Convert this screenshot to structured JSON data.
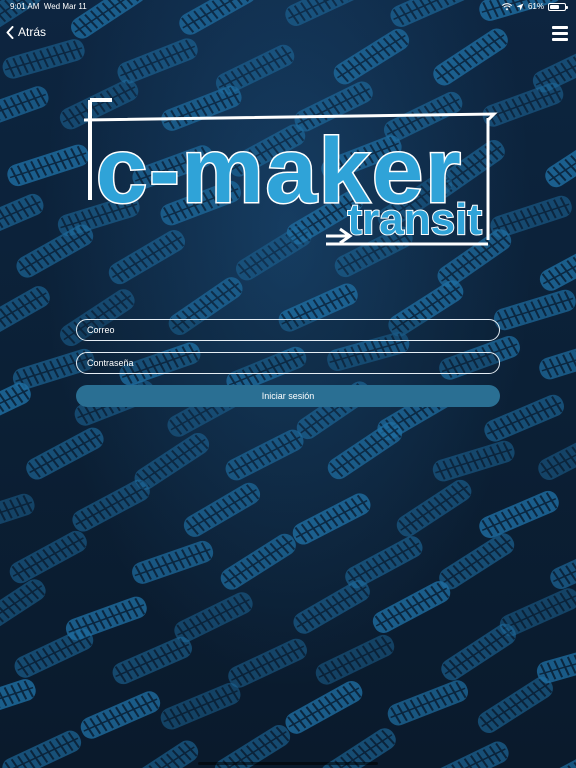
{
  "status_bar": {
    "time": "9:01 AM",
    "date": "Wed Mar 11",
    "battery_percent": "61%",
    "battery_level": 0.61,
    "icons": [
      "wifi-icon",
      "location-arrow-icon",
      "battery-icon"
    ]
  },
  "nav": {
    "back_label": "Atrás",
    "back_icon": "chevron-left-icon",
    "menu_icon": "hamburger-menu-icon"
  },
  "logo": {
    "line1": "c-maker",
    "line2": "transit"
  },
  "form": {
    "email_placeholder": "Correo",
    "password_placeholder": "Contraseña",
    "submit_label": "Iniciar sesión"
  },
  "colors": {
    "background": "#0b1e33",
    "tire_tracks": "#1f6fa3",
    "logo_blue": "#2fa3d8",
    "button": "#2a6f93",
    "text": "#ffffff"
  }
}
